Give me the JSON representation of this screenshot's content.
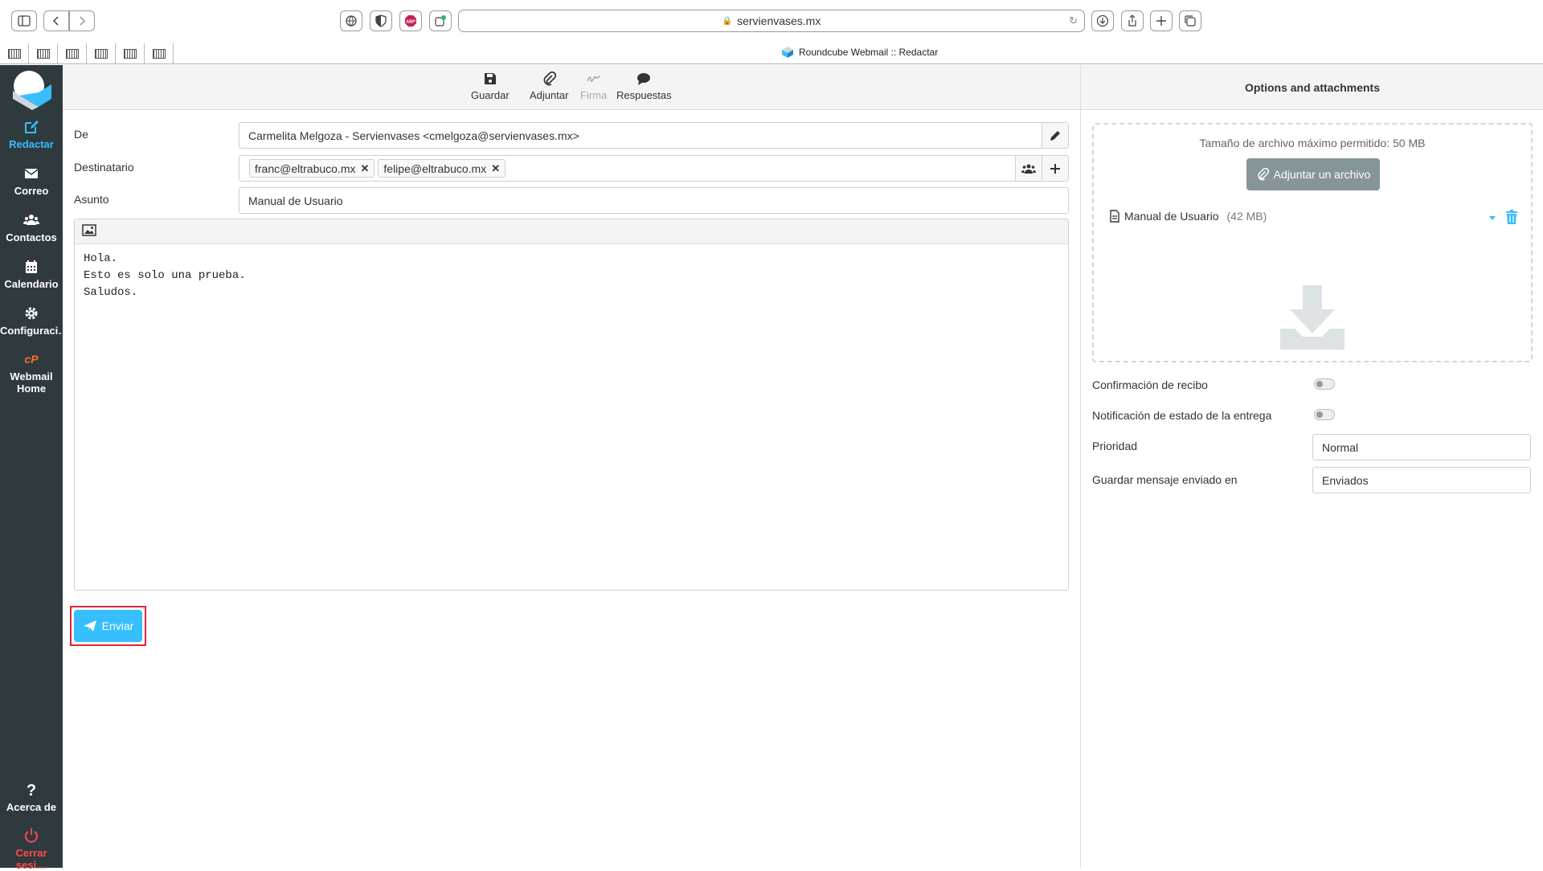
{
  "browser": {
    "url": "servienvases.mx",
    "tab_title": "Roundcube Webmail :: Redactar"
  },
  "nav": {
    "items": [
      {
        "label": "Redactar",
        "icon": "compose-icon",
        "active": true
      },
      {
        "label": "Correo",
        "icon": "envelope-icon"
      },
      {
        "label": "Contactos",
        "icon": "users-icon"
      },
      {
        "label": "Calendario",
        "icon": "calendar-icon"
      },
      {
        "label": "Configuraci…",
        "icon": "gear-icon"
      },
      {
        "label": "Webmail Home",
        "icon": "cpanel-icon"
      }
    ],
    "about": "Acerca de",
    "logout": "Cerrar sesi…"
  },
  "toolbar": {
    "save": "Guardar",
    "attach": "Adjuntar",
    "signature": "Firma",
    "responses": "Respuestas"
  },
  "compose": {
    "from_label": "De",
    "from_value": "Carmelita Melgoza - Servienvases <cmelgoza@servienvases.mx>",
    "to_label": "Destinatario",
    "recipients": [
      "franc@eltrabuco.mx",
      "felipe@eltrabuco.mx"
    ],
    "subject_label": "Asunto",
    "subject_value": "Manual de Usuario",
    "body": "Hola.\nEsto es solo una prueba.\nSaludos.",
    "send_label": "Enviar"
  },
  "options": {
    "title": "Options and attachments",
    "max_size": "Tamaño de archivo máximo permitido: 50 MB",
    "attach_button": "Adjuntar un archivo",
    "attachment_name": "Manual de Usuario",
    "attachment_size": "(42 MB)",
    "receipt_label": "Confirmación de recibo",
    "dsn_label": "Notificación de estado de la entrega",
    "priority_label": "Prioridad",
    "priority_value": "Normal",
    "store_label": "Guardar mensaje enviado en",
    "store_value": "Enviados"
  },
  "colors": {
    "nav_bg": "#2f3a3f",
    "accent": "#37beff",
    "highlight": "#e0243a"
  }
}
